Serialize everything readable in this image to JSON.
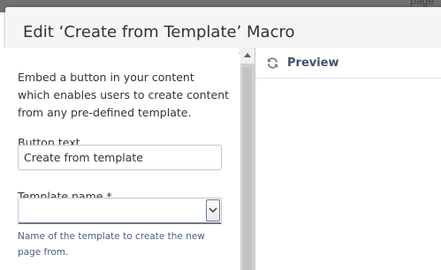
{
  "backdrop": {
    "partial_text": "page"
  },
  "dialog": {
    "title": "Edit ‘Create from Template’ Macro"
  },
  "form": {
    "description": "Embed a button in your content which enables users to create content from any pre-defined template.",
    "button_text_label": "Button text",
    "button_text_value": "Create from template",
    "template_name_label": "Template name *",
    "template_name_value": "",
    "template_name_help": "Name of the template to create the new page from."
  },
  "preview": {
    "label": "Preview",
    "icon": "refresh-icon"
  },
  "icons": {
    "select_arrow": "chevron-down-icon",
    "scroll_up": "scroll-up-arrow-icon"
  },
  "colors": {
    "header_bg": "#f4f5f7",
    "text": "#333333",
    "preview_label": "#42526e",
    "border": "#c1c7d0"
  }
}
